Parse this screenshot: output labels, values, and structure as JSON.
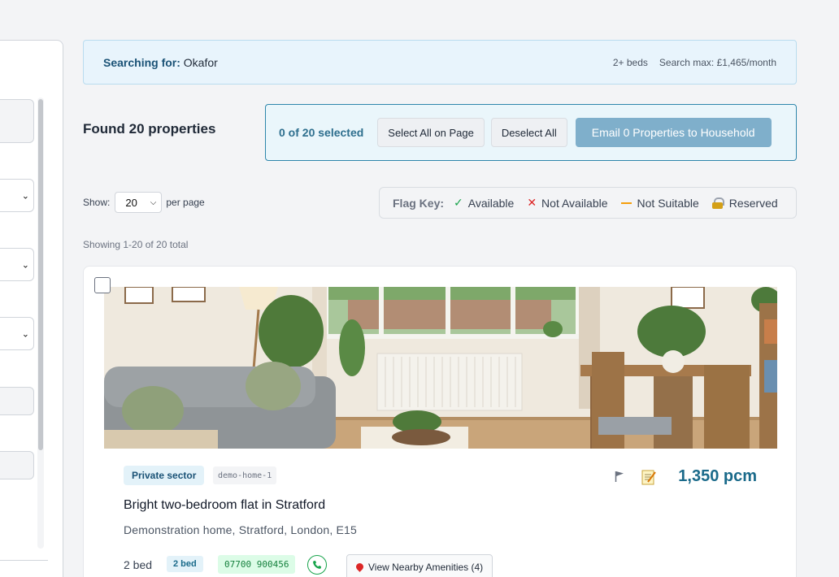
{
  "search": {
    "label": "Searching for:",
    "name": "Okafor",
    "beds": "2+ beds",
    "max": "Search max: £1,465/month"
  },
  "results": {
    "found": "Found 20 properties",
    "selected": "0 of 20 selected",
    "select_all": "Select All on Page",
    "deselect_all": "Deselect All",
    "email": "Email 0 Properties to Household",
    "show_label": "Show:",
    "per_page_value": "20",
    "per_page_label": "per page",
    "showing": "Showing 1-20 of 20 total"
  },
  "flag_key": {
    "label": "Flag Key:",
    "items": [
      {
        "icon": "check-icon",
        "label": "Available",
        "color": "#16a34a"
      },
      {
        "icon": "x-icon",
        "label": "Not Available",
        "color": "#dc2626"
      },
      {
        "icon": "dash-icon",
        "label": "Not Suitable",
        "color": "#f59e0b"
      },
      {
        "icon": "lock-icon",
        "label": "Reserved",
        "color": "#d4a017"
      }
    ]
  },
  "property": {
    "sector": "Private sector",
    "id": "demo-home-1",
    "price": "1,350 pcm",
    "title": "Bright two-bedroom flat in Stratford",
    "address": "Demonstration home, Stratford, London, E15",
    "beds_text": "2 bed",
    "beds_badge": "2 bed",
    "phone": "07700 900456",
    "amenities": "View Nearby Amenities (4)"
  },
  "colors": {
    "accent": "#1a6a8a",
    "banner_bg": "#e8f4fc",
    "email_button": "#7fafcb"
  }
}
